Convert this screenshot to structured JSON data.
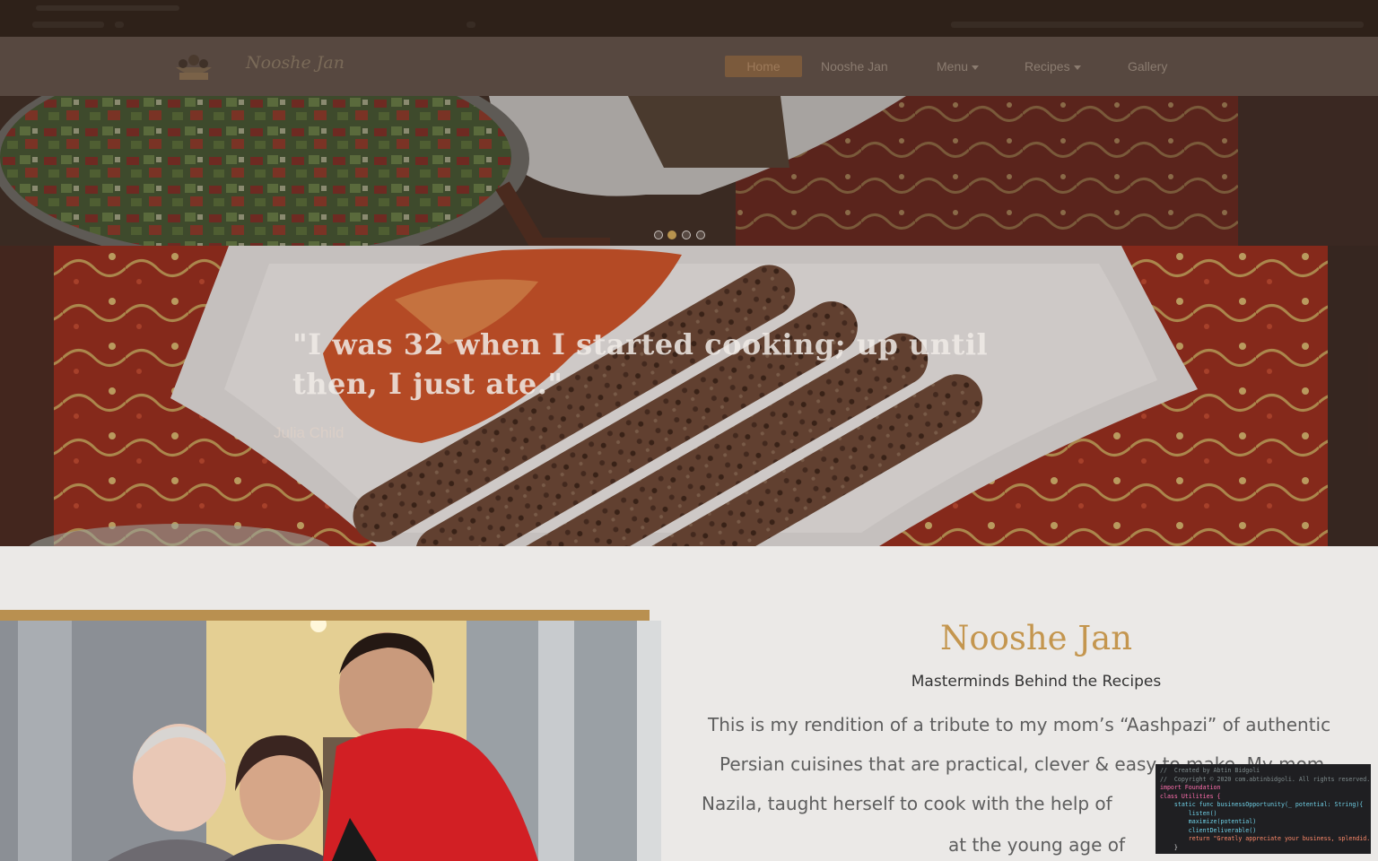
{
  "brand": {
    "name": "Nooshe Jan"
  },
  "nav": {
    "items": [
      {
        "label": "Home",
        "active": true
      },
      {
        "label": "Nooshe Jan"
      },
      {
        "label": "Menu",
        "dropdown": true
      },
      {
        "label": "Recipes",
        "dropdown": true
      },
      {
        "label": "Gallery"
      }
    ]
  },
  "carousel": {
    "slide_count": 4,
    "active_index": 1,
    "quote": "\"I was 32 when I started cooking; up until then, I just ate.\"",
    "quote_line1": "\"I was 32 when I started cooking; up until",
    "quote_line2": "then, I just ate.\"",
    "author": "Julia Child"
  },
  "about": {
    "title": "Nooshe Jan",
    "subtitle": "Masterminds Behind the Recipes",
    "lines": [
      "This is my rendition of a tribute to my mom’s “Aashpazi” of authentic",
      "Persian cuisines that are practical, clever & easy to make. My mom,",
      "Nazila, taught herself to cook with the help of",
      "at the young age of"
    ]
  },
  "code_overlay": {
    "lines": [
      "//  Created by Abtin Bidgoli",
      "//  Copyright © 2020 com.abtinbidgoli. All rights reserved.",
      "import Foundation",
      "class Utilities {",
      "    static func businessOpportunity(_ potential: String){",
      "        listen()",
      "        maximize(potential)",
      "        clientDeliverable()",
      "        return \"Greatly appreciate your business, splendid.\"",
      "    }"
    ]
  },
  "colors": {
    "accent": "#c4964f",
    "navbar": "#574840",
    "active_nav": "#7b5a3c"
  }
}
